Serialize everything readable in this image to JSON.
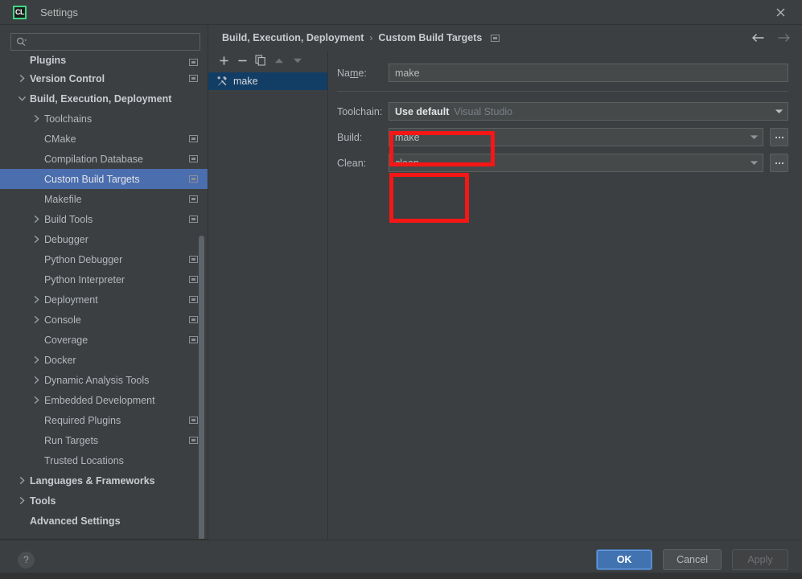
{
  "window": {
    "title": "Settings",
    "logo_text": "CL",
    "close_label": "✕"
  },
  "search": {
    "value": "",
    "placeholder": ""
  },
  "sidebar": {
    "items": [
      {
        "label": "Plugins",
        "bold": true,
        "indent": 0,
        "arrow": "none",
        "badge": true,
        "selected": false,
        "clipped": true
      },
      {
        "label": "Version Control",
        "bold": true,
        "indent": 0,
        "arrow": "right",
        "badge": true,
        "selected": false
      },
      {
        "label": "Build, Execution, Deployment",
        "bold": true,
        "indent": 0,
        "arrow": "down",
        "badge": false,
        "selected": false
      },
      {
        "label": "Toolchains",
        "bold": false,
        "indent": 1,
        "arrow": "right",
        "badge": false,
        "selected": false
      },
      {
        "label": "CMake",
        "bold": false,
        "indent": 1,
        "arrow": "none",
        "badge": true,
        "selected": false
      },
      {
        "label": "Compilation Database",
        "bold": false,
        "indent": 1,
        "arrow": "none",
        "badge": true,
        "selected": false
      },
      {
        "label": "Custom Build Targets",
        "bold": false,
        "indent": 1,
        "arrow": "none",
        "badge": true,
        "selected": true
      },
      {
        "label": "Makefile",
        "bold": false,
        "indent": 1,
        "arrow": "none",
        "badge": true,
        "selected": false
      },
      {
        "label": "Build Tools",
        "bold": false,
        "indent": 1,
        "arrow": "right",
        "badge": true,
        "selected": false
      },
      {
        "label": "Debugger",
        "bold": false,
        "indent": 1,
        "arrow": "right",
        "badge": false,
        "selected": false
      },
      {
        "label": "Python Debugger",
        "bold": false,
        "indent": 1,
        "arrow": "none",
        "badge": true,
        "selected": false
      },
      {
        "label": "Python Interpreter",
        "bold": false,
        "indent": 1,
        "arrow": "none",
        "badge": true,
        "selected": false
      },
      {
        "label": "Deployment",
        "bold": false,
        "indent": 1,
        "arrow": "right",
        "badge": true,
        "selected": false
      },
      {
        "label": "Console",
        "bold": false,
        "indent": 1,
        "arrow": "right",
        "badge": true,
        "selected": false
      },
      {
        "label": "Coverage",
        "bold": false,
        "indent": 1,
        "arrow": "none",
        "badge": true,
        "selected": false
      },
      {
        "label": "Docker",
        "bold": false,
        "indent": 1,
        "arrow": "right",
        "badge": false,
        "selected": false
      },
      {
        "label": "Dynamic Analysis Tools",
        "bold": false,
        "indent": 1,
        "arrow": "right",
        "badge": false,
        "selected": false
      },
      {
        "label": "Embedded Development",
        "bold": false,
        "indent": 1,
        "arrow": "right",
        "badge": false,
        "selected": false
      },
      {
        "label": "Required Plugins",
        "bold": false,
        "indent": 1,
        "arrow": "none",
        "badge": true,
        "selected": false
      },
      {
        "label": "Run Targets",
        "bold": false,
        "indent": 1,
        "arrow": "none",
        "badge": true,
        "selected": false
      },
      {
        "label": "Trusted Locations",
        "bold": false,
        "indent": 1,
        "arrow": "none",
        "badge": false,
        "selected": false
      },
      {
        "label": "Languages & Frameworks",
        "bold": true,
        "indent": 0,
        "arrow": "right",
        "badge": false,
        "selected": false
      },
      {
        "label": "Tools",
        "bold": true,
        "indent": 0,
        "arrow": "right",
        "badge": false,
        "selected": false
      },
      {
        "label": "Advanced Settings",
        "bold": true,
        "indent": 0,
        "arrow": "none",
        "badge": false,
        "selected": false
      }
    ]
  },
  "breadcrumb": {
    "parent": "Build, Execution, Deployment",
    "separator": "›",
    "current": "Custom Build Targets"
  },
  "targets": {
    "toolbar": [
      {
        "name": "add-target-button",
        "glyph": "+"
      },
      {
        "name": "remove-target-button",
        "glyph": "−"
      },
      {
        "name": "copy-target-button",
        "glyph": "copy"
      },
      {
        "name": "move-up-button",
        "glyph": "▲"
      },
      {
        "name": "move-down-button",
        "glyph": "▼"
      }
    ],
    "items": [
      {
        "label": "make",
        "selected": true
      }
    ]
  },
  "form": {
    "name": {
      "label": "Name:",
      "label_pre": "Na",
      "label_mnemonic": "m",
      "label_post": "e:",
      "value": "make"
    },
    "toolchain": {
      "label": "Toolchain:",
      "value_strong": "Use default",
      "value_dim": "Visual Studio"
    },
    "build": {
      "label": "Build:",
      "value": "make",
      "browse_label": "..."
    },
    "clean": {
      "label": "Clean:",
      "value": "clean",
      "browse_label": "..."
    }
  },
  "footer": {
    "help_label": "?",
    "ok_label": "OK",
    "cancel_label": "Cancel",
    "apply_label": "Apply",
    "apply_disabled": true
  },
  "colors": {
    "background": "#3c3f41",
    "selection_blue": "#4b6eaf",
    "target_selection": "#123e66",
    "accent_button": "#4173b0",
    "annotation_red": "#f51616",
    "logo_green": "#3ddb85"
  }
}
